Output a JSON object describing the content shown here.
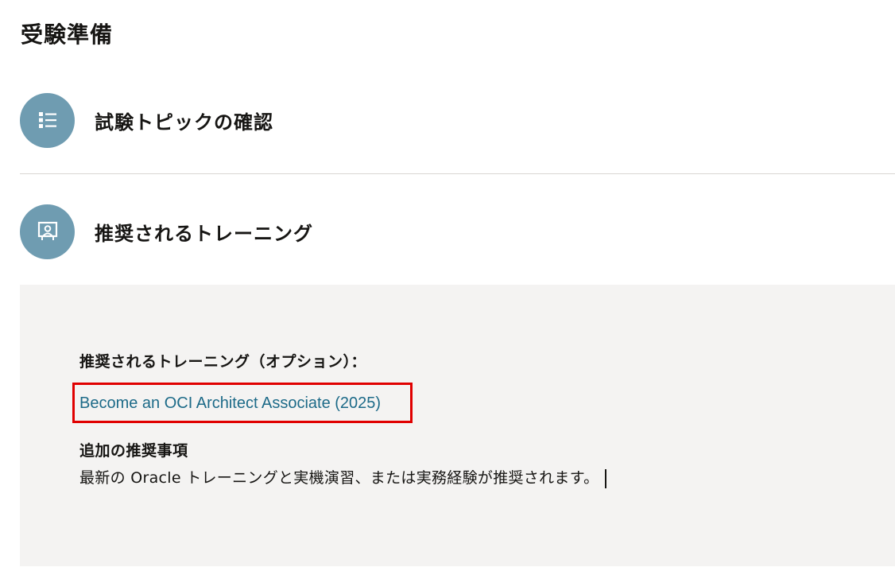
{
  "page": {
    "title": "受験準備"
  },
  "sections": [
    {
      "label": "試験トピックの確認",
      "icon": "list-icon"
    },
    {
      "label": "推奨されるトレーニング",
      "icon": "presentation-icon"
    }
  ],
  "training_panel": {
    "heading": "推奨されるトレーニング（オプション）：",
    "course_link": "Become an OCI Architect Associate (2025)",
    "additional_heading": "追加の推奨事項",
    "additional_text": "最新の Oracle トレーニングと実機演習、または実務経験が推奨されます。"
  },
  "colors": {
    "icon_circle": "#6f9cb1",
    "link": "#1c6a88",
    "highlight_box": "#e00000",
    "panel_background": "#f4f3f2"
  }
}
